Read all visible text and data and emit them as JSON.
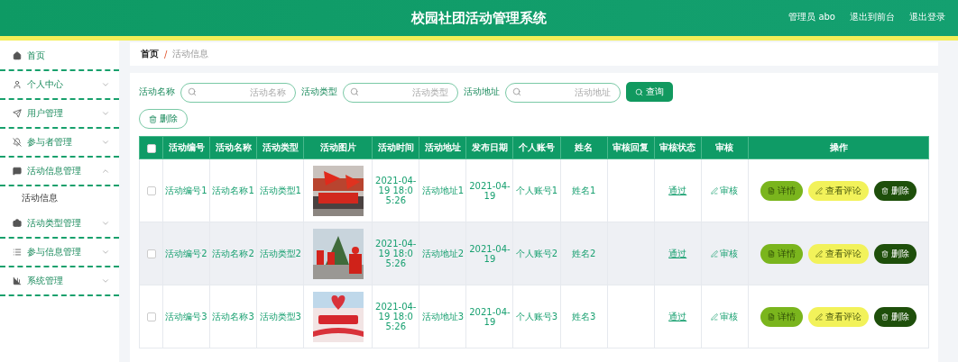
{
  "header": {
    "title": "校园社团活动管理系统",
    "user": "管理员 abo",
    "links": [
      "退出到前台",
      "退出登录"
    ]
  },
  "sidebar": {
    "items": [
      {
        "label": "首页",
        "kind": "link"
      },
      {
        "label": "个人中心",
        "kind": "menu",
        "expanded": false
      },
      {
        "label": "用户管理",
        "kind": "menu",
        "expanded": false
      },
      {
        "label": "参与者管理",
        "kind": "menu",
        "expanded": false
      },
      {
        "label": "活动信息管理",
        "kind": "menu",
        "expanded": true,
        "children": [
          {
            "label": "活动信息"
          }
        ]
      },
      {
        "label": "活动类型管理",
        "kind": "menu",
        "expanded": false
      },
      {
        "label": "参与信息管理",
        "kind": "menu",
        "expanded": false
      },
      {
        "label": "系统管理",
        "kind": "menu",
        "expanded": false
      }
    ]
  },
  "breadcrumb": {
    "home": "首页",
    "separator": "/",
    "current": "活动信息"
  },
  "search": {
    "fields": [
      {
        "label": "活动名称",
        "placeholder": "活动名称"
      },
      {
        "label": "活动类型",
        "placeholder": "活动类型"
      },
      {
        "label": "活动地址",
        "placeholder": "活动地址"
      }
    ],
    "button": "查询"
  },
  "delete_button": "删除",
  "table": {
    "header_checked": false,
    "columns": [
      "活动编号",
      "活动名称",
      "活动类型",
      "活动图片",
      "活动时间",
      "活动地址",
      "发布日期",
      "个人账号",
      "姓名",
      "审核回复",
      "审核状态",
      "审核",
      "操作"
    ],
    "rows": [
      {
        "checked": false,
        "cells": [
          "活动编号1",
          "活动名称1",
          "活动类型1",
          "",
          "2021-04-19 18:05:26",
          "活动地址1",
          "2021-04-19",
          "个人账号1",
          "姓名1",
          "",
          "通过"
        ],
        "review": "审核",
        "actions": [
          "详情",
          "查看评论",
          "删除"
        ]
      },
      {
        "checked": false,
        "cells": [
          "活动编号2",
          "活动名称2",
          "活动类型2",
          "",
          "2021-04-19 18:05:26",
          "活动地址2",
          "2021-04-19",
          "个人账号2",
          "姓名2",
          "",
          "通过"
        ],
        "review": "审核",
        "actions": [
          "详情",
          "查看评论",
          "删除"
        ]
      },
      {
        "checked": false,
        "cells": [
          "活动编号3",
          "活动名称3",
          "活动类型3",
          "",
          "2021-04-19 18:05:26",
          "活动地址3",
          "2021-04-19",
          "个人账号3",
          "姓名3",
          "",
          "通过"
        ],
        "review": "审核",
        "actions": [
          "详情",
          "查看评论",
          "删除"
        ]
      }
    ]
  }
}
